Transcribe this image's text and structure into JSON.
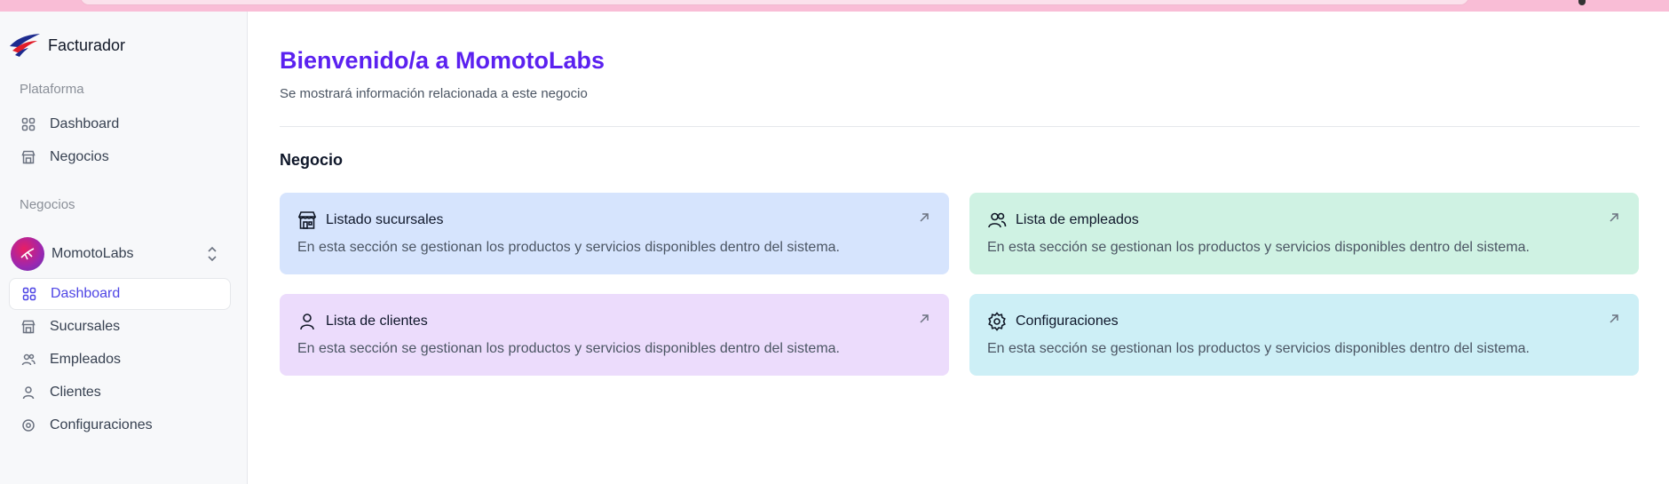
{
  "app": {
    "name": "Facturador"
  },
  "sidebar": {
    "platform_label": "Plataforma",
    "platform_items": [
      {
        "label": "Dashboard",
        "icon": "grid-icon"
      },
      {
        "label": "Negocios",
        "icon": "store-icon"
      }
    ],
    "business_label": "Negocios",
    "business": {
      "name": "MomotoLabs"
    },
    "business_items": [
      {
        "label": "Dashboard",
        "icon": "grid-icon",
        "active": true
      },
      {
        "label": "Sucursales",
        "icon": "store-icon"
      },
      {
        "label": "Empleados",
        "icon": "users-icon"
      },
      {
        "label": "Clientes",
        "icon": "user-icon"
      },
      {
        "label": "Configuraciones",
        "icon": "gear-icon"
      }
    ]
  },
  "main": {
    "title": "Bienvenido/a a MomotoLabs",
    "subtitle": "Se mostrará información relacionada a este negocio",
    "section_title": "Negocio",
    "cards": [
      {
        "title": "Listado sucursales",
        "description": "En esta sección se gestionan los productos y servicios disponibles dentro del sistema.",
        "icon": "store-icon",
        "color": "#d6e4fd"
      },
      {
        "title": "Lista de empleados",
        "description": "En esta sección se gestionan los productos y servicios disponibles dentro del sistema.",
        "icon": "users-icon",
        "color": "#cff2e3"
      },
      {
        "title": "Lista de clientes",
        "description": "En esta sección se gestionan los productos y servicios disponibles dentro del sistema.",
        "icon": "user-icon",
        "color": "#ecdcfc"
      },
      {
        "title": "Configuraciones",
        "description": "En esta sección se gestionan los productos y servicios disponibles dentro del sistema.",
        "icon": "gear-icon",
        "color": "#cdeff6"
      }
    ]
  },
  "colors": {
    "accent": "#5b21f0",
    "active_nav": "#4f46e5"
  }
}
